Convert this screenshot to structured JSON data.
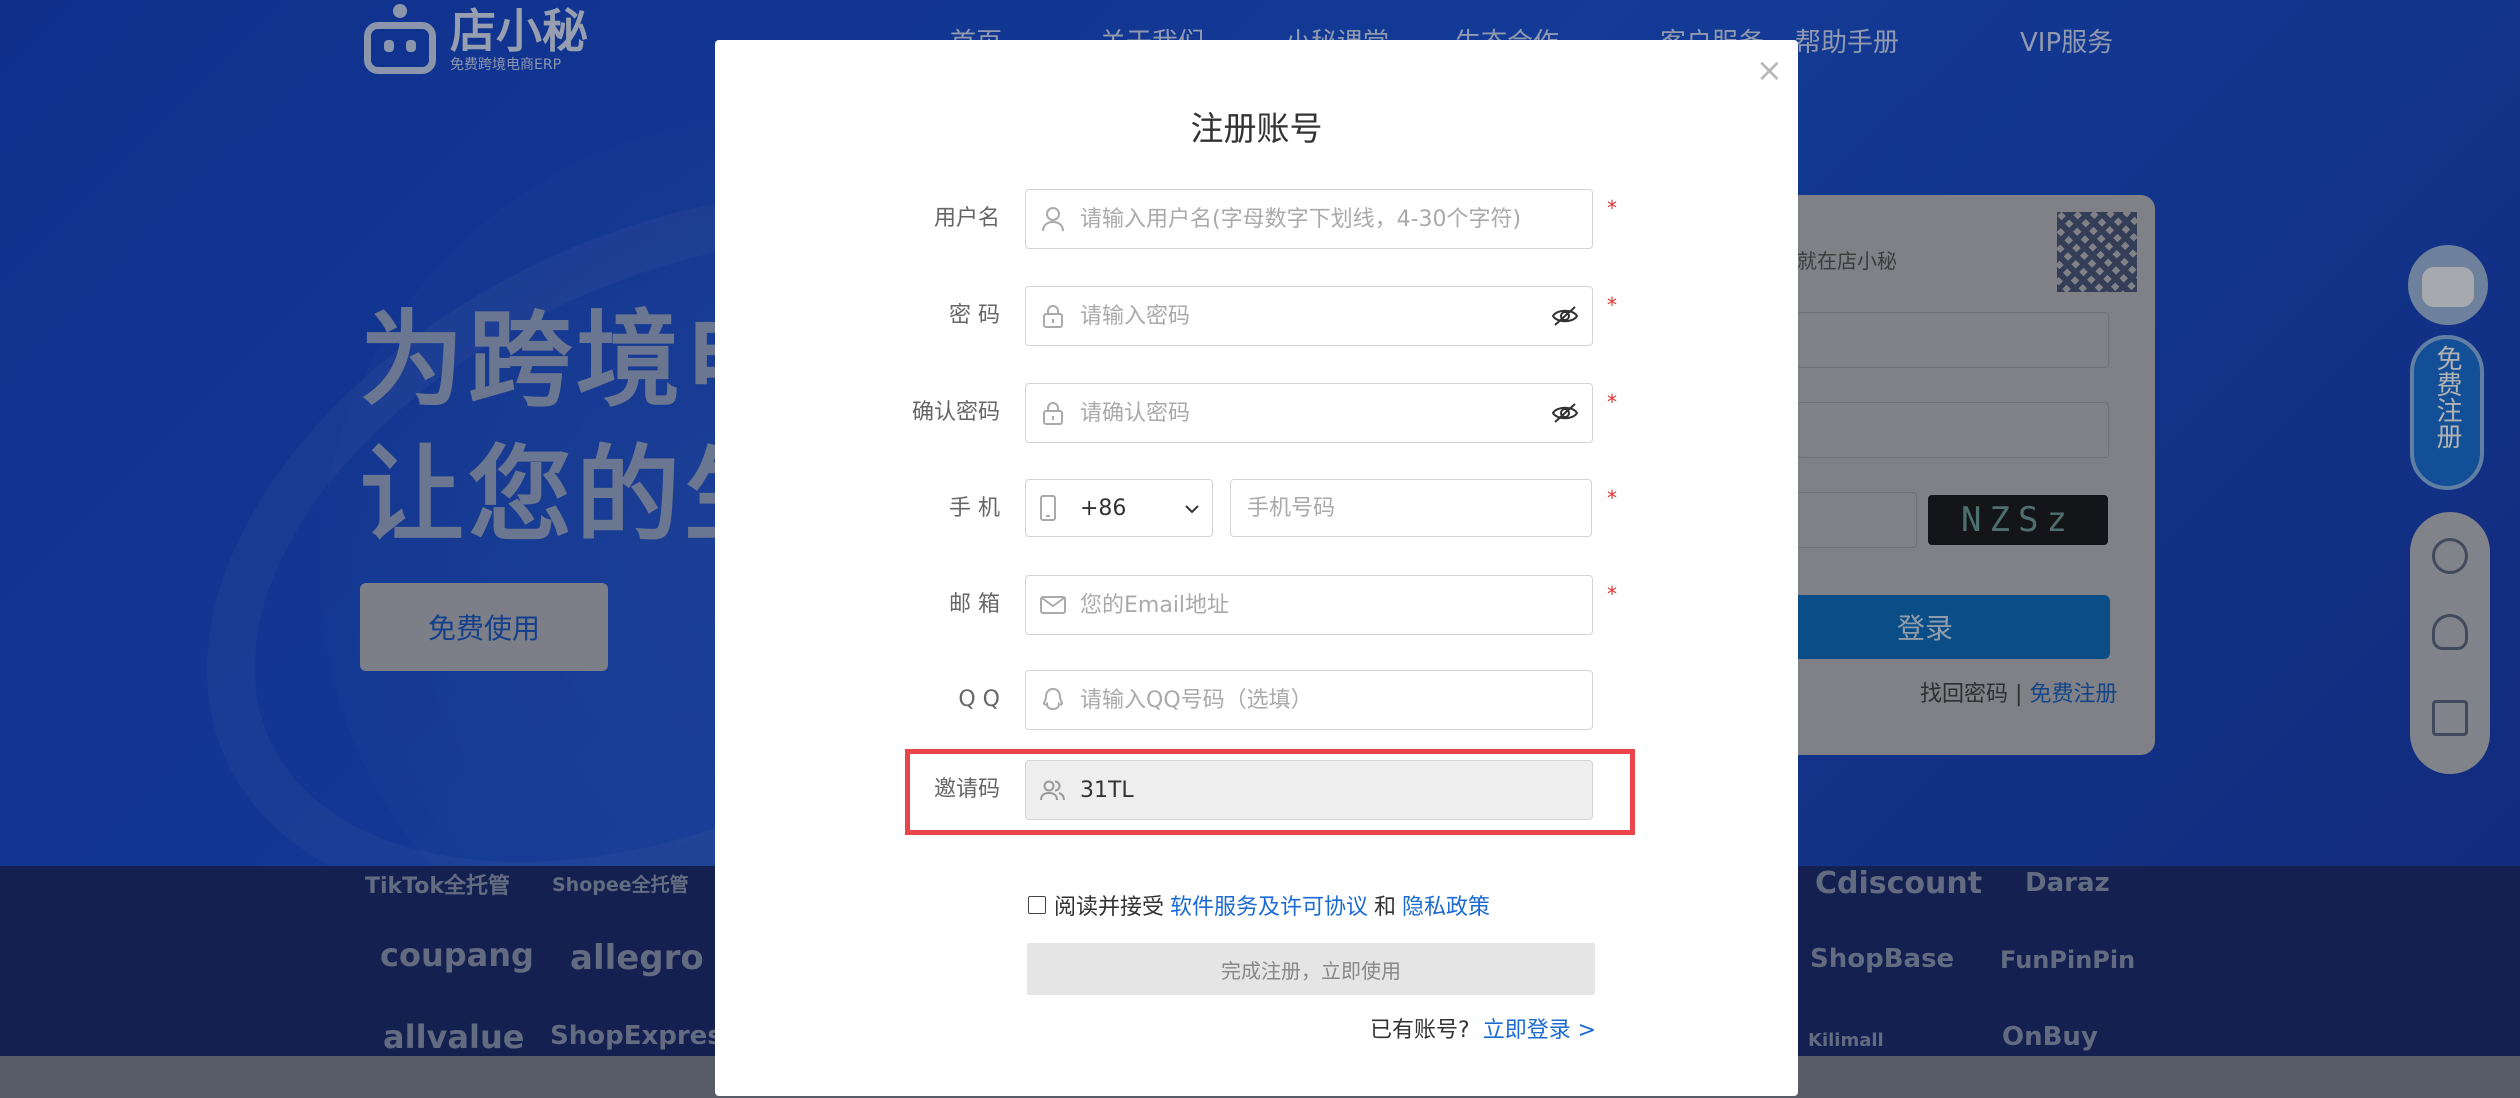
{
  "background": {
    "logo": {
      "name": "店小秘",
      "tagline": "免费跨境电商ERP"
    },
    "nav": [
      "首页",
      "关于我们",
      "小秘课堂",
      "生态合作",
      "客户服务",
      "帮助手册",
      "VIP服务"
    ],
    "hero": {
      "line1": "为跨境电",
      "line2": "让您的生",
      "cta": "免费使用"
    },
    "login_card": {
      "hint": "就在店小秘",
      "captcha": "NZSz",
      "login_button": "登录",
      "forgot": "找回密码",
      "separator": "|",
      "register": "免费注册"
    },
    "side_register": "免费注册",
    "brands": [
      "TikTok全托管",
      "Shopee全托管",
      "Cdiscount",
      "Daraz",
      "coupang",
      "allegro",
      "ShopBase",
      "FunPinPin",
      "allvalue",
      "ShopExpress",
      "Kilimall",
      "OnBuy"
    ]
  },
  "modal": {
    "title": "注册账号",
    "close": "×",
    "fields": {
      "username": {
        "label": "用户名",
        "placeholder": "请输入用户名(字母数字下划线，4-30个字符)",
        "required": "*"
      },
      "password": {
        "label": "密  码",
        "placeholder": "请输入密码",
        "required": "*"
      },
      "confirm": {
        "label": "确认密码",
        "placeholder": "请确认密码",
        "required": "*"
      },
      "phone": {
        "label": "手  机",
        "country_code": "+86",
        "placeholder": "手机号码",
        "required": "*"
      },
      "email": {
        "label": "邮  箱",
        "placeholder": "您的Email地址",
        "required": "*"
      },
      "qq": {
        "label": "Q  Q",
        "placeholder": "请输入QQ号码（选填）"
      },
      "invite": {
        "label": "邀请码",
        "value": "31TL"
      }
    },
    "agreement": {
      "prefix": "阅读并接受",
      "terms": "软件服务及许可协议",
      "and": "和",
      "privacy": "隐私政策"
    },
    "submit": "完成注册，立即使用",
    "login_prompt": {
      "text": "已有账号?",
      "link": "立即登录 >"
    }
  }
}
